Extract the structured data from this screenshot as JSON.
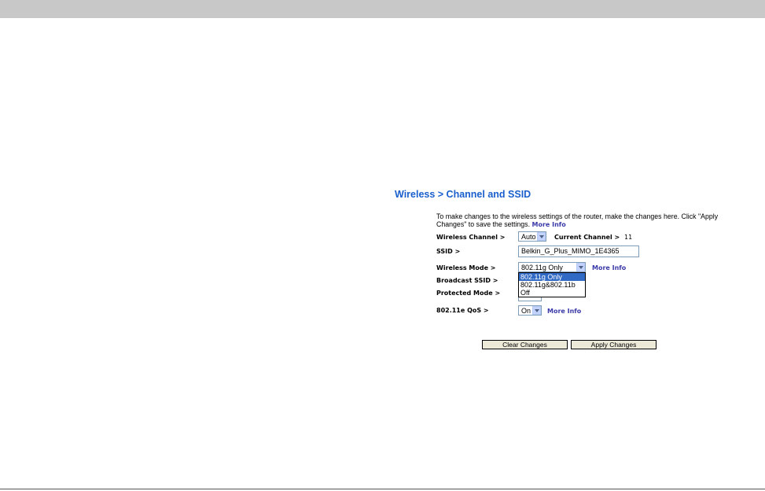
{
  "page_title": "Wireless > Channel and SSID",
  "intro": {
    "text": "To make changes to the wireless settings of the router, make the changes here. Click \"Apply Changes\" to save the settings.",
    "more_info": "More Info"
  },
  "wireless_channel": {
    "label": "Wireless Channel >",
    "value": "Auto",
    "current_label": "Current Channel >",
    "current_value": "11"
  },
  "ssid": {
    "label": "SSID >",
    "value": "Belkin_G_Plus_MIMO_1E4365"
  },
  "wireless_mode": {
    "label": "Wireless Mode >",
    "value": "802.11g Only",
    "more_info": "More Info",
    "options": [
      "802.11g Only",
      "802.11g&802.11b",
      "Off"
    ]
  },
  "broadcast_ssid": {
    "label": "Broadcast SSID >"
  },
  "protected_mode": {
    "label": "Protected Mode >"
  },
  "qos": {
    "label": "802.11e QoS >",
    "value": "On",
    "more_info": "More Info"
  },
  "buttons": {
    "clear": "Clear Changes",
    "apply": "Apply Changes"
  }
}
